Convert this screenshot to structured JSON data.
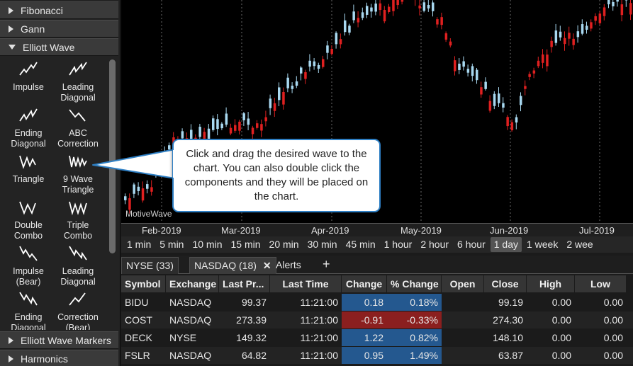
{
  "left_panel": {
    "sections_top": [
      {
        "label": "Fibonacci",
        "expanded": false
      },
      {
        "label": "Gann",
        "expanded": false
      },
      {
        "label": "Elliott Wave",
        "expanded": true
      }
    ],
    "wave_items": [
      {
        "label": "Impulse",
        "icon": "impulse-wave-icon"
      },
      {
        "label": "Leading Diagonal",
        "icon": "leading-diagonal-icon"
      },
      {
        "label": "Ending Diagonal",
        "icon": "ending-diagonal-icon"
      },
      {
        "label": "ABC Correction",
        "icon": "abc-correction-icon"
      },
      {
        "label": "Triangle",
        "icon": "triangle-wave-icon"
      },
      {
        "label": "9 Wave Triangle",
        "icon": "nine-wave-triangle-icon"
      },
      {
        "label": "Double Combo",
        "icon": "double-combo-icon"
      },
      {
        "label": "Triple Combo",
        "icon": "triple-combo-icon"
      },
      {
        "label": "Impulse (Bear)",
        "icon": "impulse-bear-icon"
      },
      {
        "label": "Leading Diagonal",
        "icon": "leading-diagonal-bear-icon"
      },
      {
        "label": "Ending Diagonal",
        "icon": "ending-diagonal-bear-icon"
      },
      {
        "label": "Correction (Bear)",
        "icon": "correction-bear-icon"
      }
    ],
    "sections_bottom": [
      {
        "label": "Elliott Wave Markers",
        "expanded": false
      },
      {
        "label": "Harmonics",
        "expanded": false
      }
    ]
  },
  "chart": {
    "watermark": "MotiveWave",
    "x_labels": [
      "Feb-2019",
      "Mar-2019",
      "Apr-2019",
      "May-2019",
      "Jun-2019",
      "Jul-2019"
    ],
    "up_color": "#a8d8f0",
    "down_color": "#e02020"
  },
  "callout": {
    "text": "Click and drag the desired wave to the chart. You can also double click the components and they will be placed on the chart."
  },
  "timeframes": {
    "items": [
      "1 min",
      "5 min",
      "10 min",
      "15 min",
      "20 min",
      "30 min",
      "45 min",
      "1 hour",
      "2 hour",
      "6 hour",
      "1 day",
      "1 week",
      "2 wee"
    ],
    "selected": "1 day"
  },
  "tabs": {
    "items": [
      "NYSE (33)",
      "NASDAQ (18)",
      "Alerts"
    ],
    "active": "NASDAQ (18)",
    "add_label": "+"
  },
  "table": {
    "columns": [
      "Symbol",
      "Exchange",
      "Last Pr...",
      "Last Time",
      "Change",
      "% Change",
      "Open",
      "Close",
      "High",
      "Low"
    ],
    "rows": [
      {
        "symbol": "BIDU",
        "exchange": "NASDAQ",
        "last": "99.37",
        "time": "11:21:00",
        "change": "0.18",
        "pct": "0.18%",
        "open": "",
        "close": "99.19",
        "high": "0.00",
        "low": "0.00",
        "dir": "pos"
      },
      {
        "symbol": "COST",
        "exchange": "NASDAQ",
        "last": "273.39",
        "time": "11:21:00",
        "change": "-0.91",
        "pct": "-0.33%",
        "open": "",
        "close": "274.30",
        "high": "0.00",
        "low": "0.00",
        "dir": "neg"
      },
      {
        "symbol": "DECK",
        "exchange": "NYSE",
        "last": "149.32",
        "time": "11:21:00",
        "change": "1.22",
        "pct": "0.82%",
        "open": "",
        "close": "148.10",
        "high": "0.00",
        "low": "0.00",
        "dir": "pos"
      },
      {
        "symbol": "FSLR",
        "exchange": "NASDAQ",
        "last": "64.82",
        "time": "11:21:00",
        "change": "0.95",
        "pct": "1.49%",
        "open": "",
        "close": "63.87",
        "high": "0.00",
        "low": "0.00",
        "dir": "pos"
      }
    ]
  }
}
